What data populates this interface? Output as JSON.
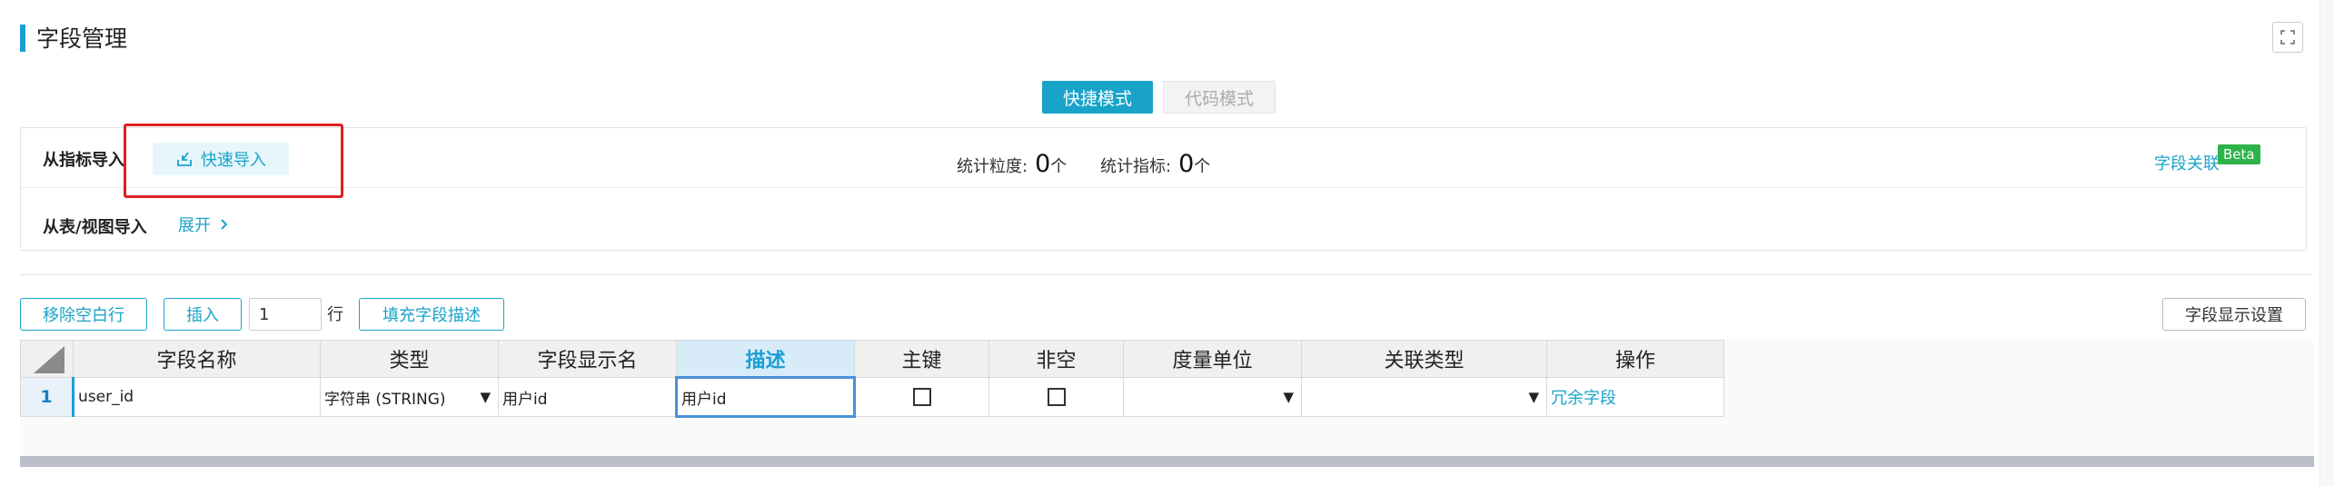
{
  "header": {
    "title": "字段管理",
    "fullscreen_icon": "expand-icon"
  },
  "mode_tabs": [
    {
      "label": "快捷模式",
      "active": true
    },
    {
      "label": "代码模式",
      "active": false
    }
  ],
  "import_panel": {
    "from_metric_label": "从指标导入",
    "quick_import_label": "快速导入",
    "quick_import_icon": "import-icon",
    "stat_granularity_label": "统计粒度:",
    "stat_granularity_value": "0",
    "stat_granularity_unit": "个",
    "stat_metric_label": "统计指标:",
    "stat_metric_value": "0",
    "stat_metric_unit": "个",
    "field_relation_label": "字段关联",
    "beta_badge": "Beta",
    "from_table_label": "从表/视图导入",
    "expand_label": "展开",
    "expand_icon": "chevron-right-icon"
  },
  "toolbar": {
    "remove_empty_label": "移除空白行",
    "insert_label": "插入",
    "insert_count": "1",
    "row_unit": "行",
    "fill_desc_label": "填充字段描述",
    "display_settings_label": "字段显示设置"
  },
  "grid": {
    "columns": [
      "字段名称",
      "类型",
      "字段显示名",
      "描述",
      "主键",
      "非空",
      "度量单位",
      "关联类型",
      "操作"
    ],
    "active_column": "描述",
    "rows": [
      {
        "index": "1",
        "name": "user_id",
        "type": "字符串 (STRING)",
        "display_name": "用户id",
        "description": "用户id",
        "primary_key": false,
        "not_null": false,
        "unit": "",
        "relation_type": "",
        "action": "冗余字段"
      }
    ]
  },
  "colors": {
    "accent": "#1aa3c9",
    "highlight_border": "#e02020",
    "beta": "#2db34a"
  }
}
